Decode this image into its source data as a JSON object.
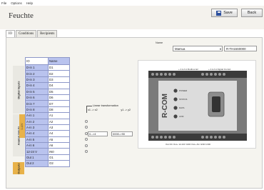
{
  "menu": [
    "File",
    "Options",
    "Help"
  ],
  "title": "Feuchte",
  "toolbar": {
    "save_label": "Save",
    "back_label": "Back"
  },
  "tabs": [
    "IO",
    "Conditions",
    "Recipients"
  ],
  "sensor": {
    "label": "Name",
    "selected": "Mamua",
    "id_value": "R-TH16S0000"
  },
  "table": {
    "headers": [
      "IO",
      "Name"
    ],
    "rows": [
      [
        "D-in 1",
        "D1"
      ],
      [
        "D-in 2",
        "D2"
      ],
      [
        "D-in 3",
        "D3"
      ],
      [
        "D-in 4",
        "D4"
      ],
      [
        "D-in 5",
        "D5"
      ],
      [
        "D-in 6",
        "D6"
      ],
      [
        "D-in 7",
        "D7"
      ],
      [
        "D-in 8",
        "D8"
      ],
      [
        "A-in 1",
        "A1"
      ],
      [
        "A-in 2",
        "A2"
      ],
      [
        "A-in 3",
        "A3"
      ],
      [
        "A-in 4",
        "A4"
      ],
      [
        "A-in 5",
        "A5"
      ],
      [
        "A-in 6",
        "A6"
      ],
      [
        "12-24 V",
        "IN0"
      ],
      [
        "Out 1",
        "O1"
      ],
      [
        "Out 2",
        "O2"
      ]
    ]
  },
  "groups": {
    "digital": "Digital Inputs",
    "analog": "Analog Inputs",
    "outputs": "Outputs",
    "analog_sub": "0-10V"
  },
  "transform": {
    "label": "Linear transformation",
    "x_label": "x1 -> x2",
    "y_label": "y1 -> y2",
    "in1": "0-->4",
    "in2": "0000->90"
  },
  "device": {
    "brand": "R-COM",
    "top_left_label": "+ A A A A Modbus E2",
    "top_right_label": "+ A A A A Digital Out E2",
    "bottom_label": "Out DC Out+ 12-24V GND Out+ AIn GND GND",
    "leds": [
      "POWER",
      "STATUS",
      "DATA",
      "LINK"
    ]
  }
}
